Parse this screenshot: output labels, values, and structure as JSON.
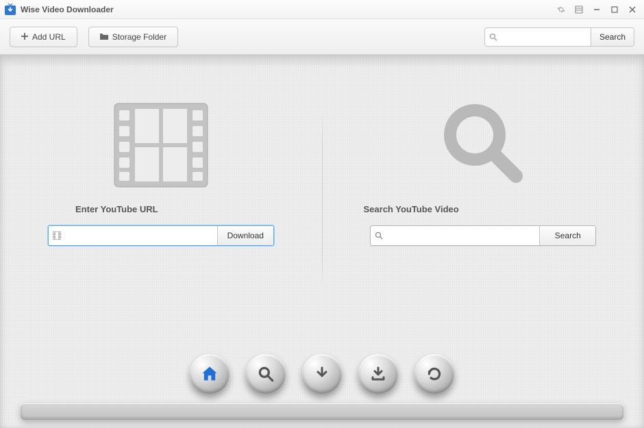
{
  "app": {
    "title": "Wise Video Downloader"
  },
  "toolbar": {
    "addUrl": "Add URL",
    "storageFolder": "Storage Folder",
    "searchBtn": "Search"
  },
  "left": {
    "title": "Enter YouTube URL",
    "button": "Download"
  },
  "right": {
    "title": "Search YouTube Video",
    "button": "Search"
  },
  "dock": {
    "home": "home",
    "search": "search",
    "download": "download",
    "downloadTo": "download-to-folder",
    "refresh": "refresh"
  }
}
